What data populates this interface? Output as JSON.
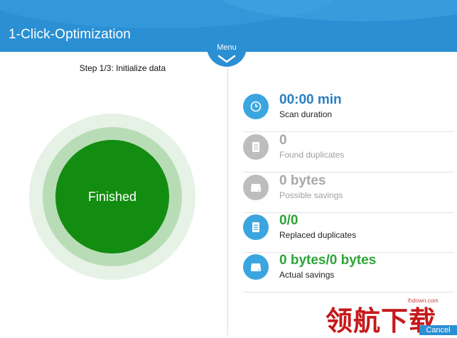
{
  "header": {
    "title": "1-Click-Optimization",
    "menu_label": "Menu"
  },
  "left": {
    "step_text": "Step 1/3: Initialize data",
    "status": "Finished"
  },
  "stats": [
    {
      "value": "00:00 min",
      "label": "Scan duration",
      "icon": "clock-icon"
    },
    {
      "value": "0",
      "label": "Found duplicates",
      "icon": "document-icon"
    },
    {
      "value": "0 bytes",
      "label": "Possible savings",
      "icon": "drive-icon"
    },
    {
      "value": "0/0",
      "label": "Replaced duplicates",
      "icon": "document-icon"
    },
    {
      "value": "0 bytes/0 bytes",
      "label": "Actual savings",
      "icon": "drive-icon"
    }
  ],
  "watermark": {
    "url": "lhdown.com",
    "text": "领航下载"
  },
  "footer": {
    "cancel_label": "Cancel"
  },
  "colors": {
    "header": "#2a8fd3",
    "finished": "#138c12",
    "value_blue": "#2a7fbf",
    "value_green": "#2ea436"
  }
}
